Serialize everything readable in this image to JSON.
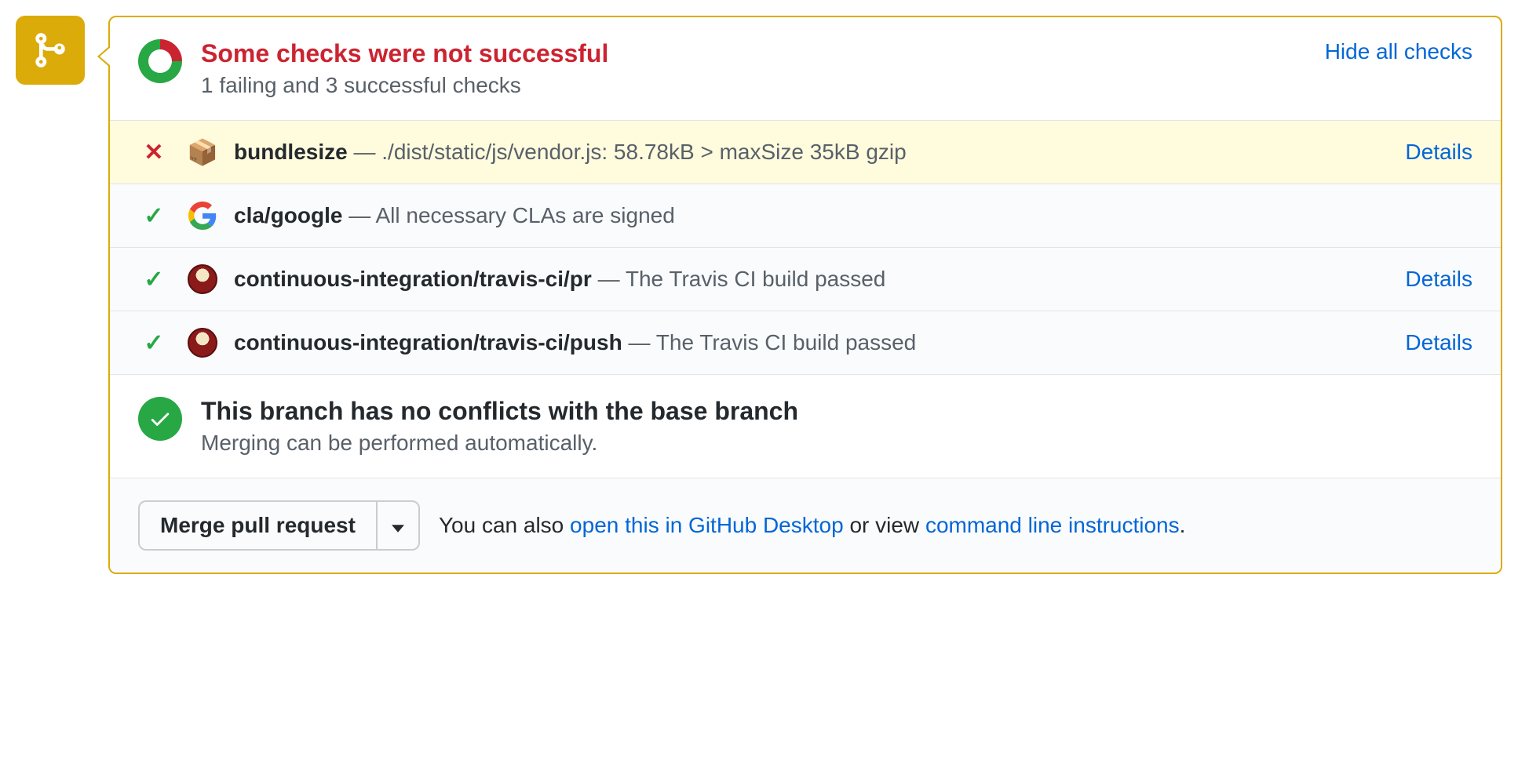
{
  "header": {
    "title": "Some checks were not successful",
    "subtitle": "1 failing and 3 successful checks",
    "toggle_label": "Hide all checks"
  },
  "checks": [
    {
      "status": "fail",
      "icon": "package",
      "name": "bundlesize",
      "sep": " — ",
      "desc": "./dist/static/js/vendor.js: 58.78kB > maxSize 35kB gzip",
      "details": "Details"
    },
    {
      "status": "pass",
      "icon": "google",
      "name": "cla/google",
      "sep": " — ",
      "desc": "All necessary CLAs are signed",
      "details": ""
    },
    {
      "status": "pass",
      "icon": "travis",
      "name": "continuous-integration/travis-ci/pr",
      "sep": " — ",
      "desc": "The Travis CI build passed",
      "details": "Details"
    },
    {
      "status": "pass",
      "icon": "travis",
      "name": "continuous-integration/travis-ci/push",
      "sep": " — ",
      "desc": "The Travis CI build passed",
      "details": "Details"
    }
  ],
  "merge_status": {
    "title": "This branch has no conflicts with the base branch",
    "subtitle": "Merging can be performed automatically."
  },
  "actions": {
    "merge_button": "Merge pull request",
    "hint_prefix": "You can also ",
    "desktop_link": "open this in GitHub Desktop",
    "hint_mid": " or view ",
    "cli_link": "command line instructions",
    "hint_suffix": "."
  }
}
